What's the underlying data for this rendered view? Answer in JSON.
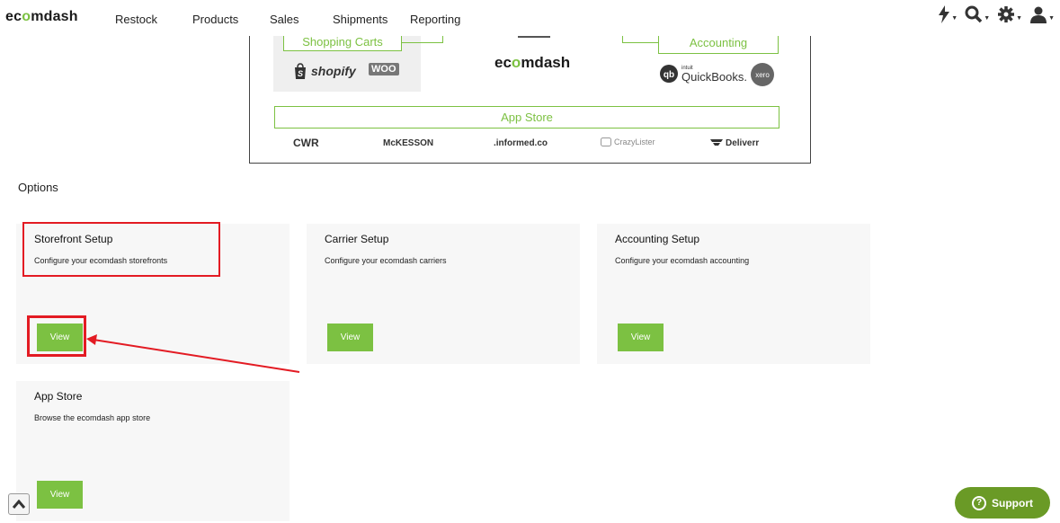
{
  "nav": {
    "brand": "ecomdash",
    "items": [
      "Restock",
      "Products",
      "Sales",
      "Shipments",
      "Reporting"
    ],
    "icons": [
      "bolt-icon",
      "search-icon",
      "gear-icon",
      "user-icon"
    ]
  },
  "diagram": {
    "shopping_carts": "Shopping Carts",
    "accounting": "Accounting",
    "app_store": "App Store",
    "center_brand": "ecomdash",
    "cart_logos": [
      "shopify",
      "WOO"
    ],
    "accounting_logos": [
      "QuickBooks.",
      "xero"
    ],
    "quickbooks_prefix": "intuit",
    "partner_logos": [
      "CWR",
      "McKESSON",
      ".informed.co",
      "CrazyLister",
      "Deliverr"
    ]
  },
  "options": {
    "title": "Options",
    "cards": [
      {
        "title": "Storefront Setup",
        "desc": "Configure your ecomdash storefronts",
        "button": "View"
      },
      {
        "title": "Carrier Setup",
        "desc": "Configure your ecomdash carriers",
        "button": "View"
      },
      {
        "title": "Accounting Setup",
        "desc": "Configure your ecomdash accounting",
        "button": "View"
      },
      {
        "title": "App Store",
        "desc": "Browse the ecomdash app store",
        "button": "View"
      }
    ]
  },
  "support": {
    "label": "Support"
  },
  "colors": {
    "accent": "#7cc142",
    "highlight": "#e31b23",
    "support": "#6a9a26"
  }
}
